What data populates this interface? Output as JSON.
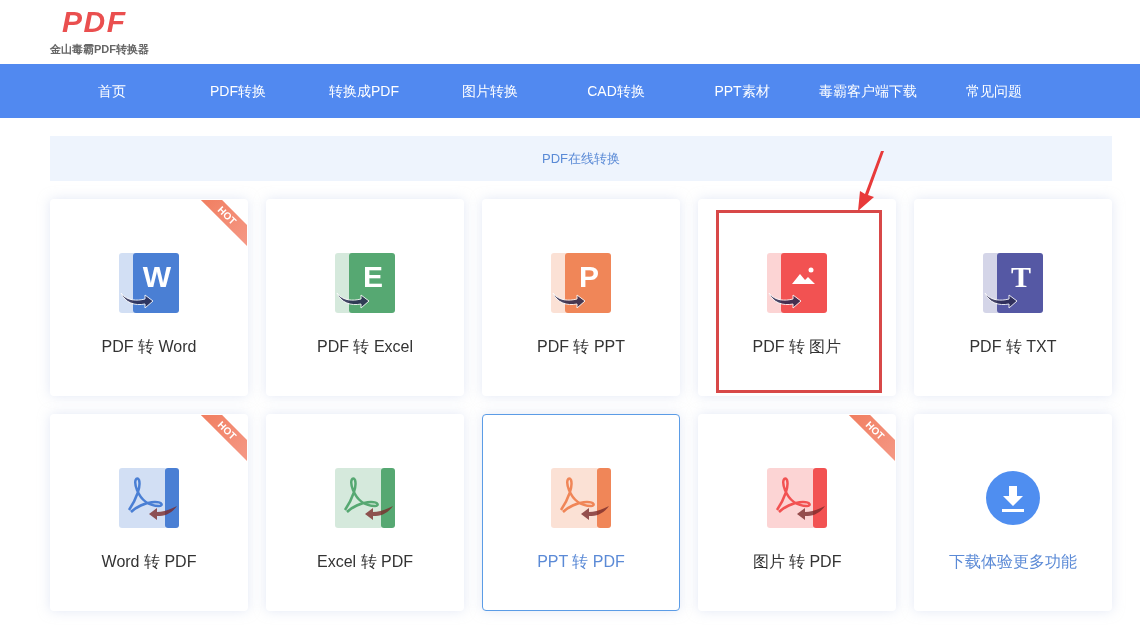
{
  "logo": {
    "mark": "PDF",
    "caption": "金山毒霸PDF转换器"
  },
  "nav": [
    {
      "label": "首页"
    },
    {
      "label": "PDF转换"
    },
    {
      "label": "转换成PDF"
    },
    {
      "label": "图片转换"
    },
    {
      "label": "CAD转换"
    },
    {
      "label": "PPT素材"
    },
    {
      "label": "毒霸客户端下载"
    },
    {
      "label": "常见问题"
    }
  ],
  "banner": "PDF在线转换",
  "cards": [
    {
      "label": "PDF 转 Word",
      "kind": "letter",
      "glyph": "W",
      "color": "#4a7fd4",
      "hot": "HOT",
      "selected": false,
      "highlighted": false
    },
    {
      "label": "PDF 转 Excel",
      "kind": "letter",
      "glyph": "E",
      "color": "#56a872",
      "selected": false,
      "highlighted": false
    },
    {
      "label": "PDF 转 PPT",
      "kind": "letter",
      "glyph": "P",
      "color": "#f08658",
      "selected": false,
      "highlighted": false
    },
    {
      "label": "PDF 转 图片",
      "kind": "image",
      "color": "#f25252",
      "selected": false,
      "highlighted": true
    },
    {
      "label": "PDF 转 TXT",
      "kind": "letter",
      "glyph": "T",
      "color": "#5558a4",
      "selected": false,
      "highlighted": false
    },
    {
      "label": "Word 转 PDF",
      "kind": "acrobat",
      "color": "#4a7fd4",
      "hot": "HOT",
      "selected": false,
      "highlighted": false
    },
    {
      "label": "Excel 转 PDF",
      "kind": "acrobat",
      "color": "#56a872",
      "selected": false,
      "highlighted": false
    },
    {
      "label": "PPT 转 PDF",
      "kind": "acrobat",
      "color": "#f08658",
      "selected": true,
      "highlighted": false
    },
    {
      "label": "图片 转 PDF",
      "kind": "acrobat",
      "color": "#f25252",
      "hot": "HOT",
      "selected": false,
      "highlighted": false
    },
    {
      "label": "下载体验更多功能",
      "kind": "download",
      "color": "#4f8ef0",
      "selected": false,
      "highlighted": false
    }
  ]
}
